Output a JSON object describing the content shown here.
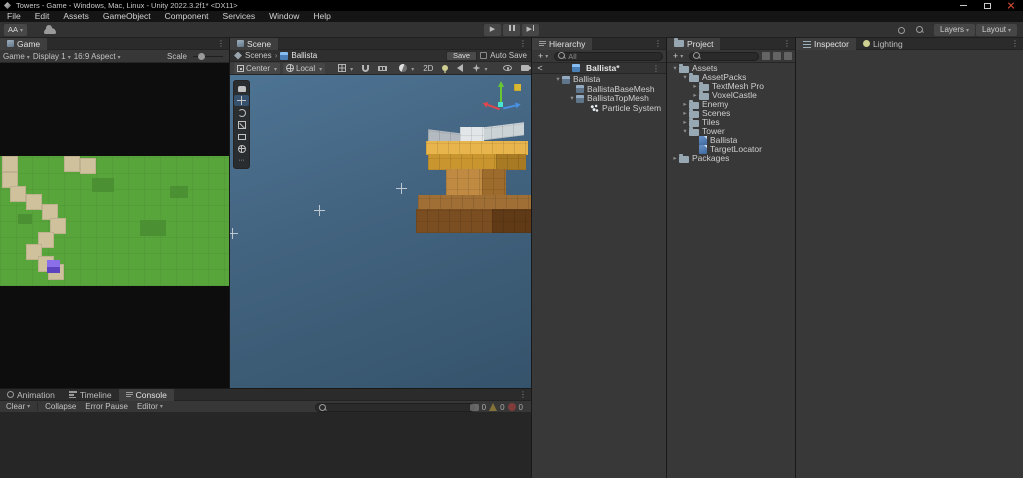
{
  "titlebar": {
    "title": "Towers - Game - Windows, Mac, Linux - Unity 2022.3.2f1* <DX11>"
  },
  "menubar": {
    "items": [
      "File",
      "Edit",
      "Assets",
      "GameObject",
      "Component",
      "Services",
      "Window",
      "Help"
    ]
  },
  "toolbar": {
    "account": "AA",
    "layers": "Layers",
    "layout": "Layout"
  },
  "game": {
    "tab": "Game",
    "mode": "Game",
    "display": "Display 1",
    "aspect": "16:9 Aspect",
    "scale_label": "Scale"
  },
  "scene": {
    "tab": "Scene",
    "breadcrumb_scene": "Scenes",
    "breadcrumb_prefab": "Ballista",
    "save": "Save",
    "auto_save": "Auto Save",
    "pivot": "Center",
    "orientation": "Local",
    "mode_2d": "2D"
  },
  "hierarchy": {
    "tab": "Hierarchy",
    "search_placeholder": "All",
    "prefab_root": "Ballista*",
    "items": [
      {
        "arrow": "▾",
        "label": "Ballista",
        "depth": 0
      },
      {
        "arrow": "",
        "label": "BallistaBaseMesh",
        "depth": 1
      },
      {
        "arrow": "▾",
        "label": "BallistaTopMesh",
        "depth": 1
      },
      {
        "arrow": "",
        "label": "Particle System",
        "depth": 2
      }
    ]
  },
  "project": {
    "tab": "Project",
    "items": [
      {
        "arrow": "▾",
        "label": "Assets",
        "depth": 0,
        "icon": "folder"
      },
      {
        "arrow": "▾",
        "label": "AssetPacks",
        "depth": 1,
        "icon": "folder"
      },
      {
        "arrow": "▸",
        "label": "TextMesh Pro",
        "depth": 2,
        "icon": "folder"
      },
      {
        "arrow": "▸",
        "label": "VoxelCastle",
        "depth": 2,
        "icon": "folder"
      },
      {
        "arrow": "▸",
        "label": "Enemy",
        "depth": 1,
        "icon": "folder"
      },
      {
        "arrow": "▸",
        "label": "Scenes",
        "depth": 1,
        "icon": "folder"
      },
      {
        "arrow": "▸",
        "label": "Tiles",
        "depth": 1,
        "icon": "folder"
      },
      {
        "arrow": "▾",
        "label": "Tower",
        "depth": 1,
        "icon": "folder"
      },
      {
        "arrow": "",
        "label": "Ballista",
        "depth": 2,
        "icon": "script"
      },
      {
        "arrow": "",
        "label": "TargetLocator",
        "depth": 2,
        "icon": "script"
      },
      {
        "arrow": "▸",
        "label": "Packages",
        "depth": 0,
        "icon": "folder"
      }
    ]
  },
  "inspector": {
    "tab": "Inspector",
    "tab_lighting": "Lighting"
  },
  "bottom": {
    "tabs": [
      "Animation",
      "Timeline",
      "Console"
    ],
    "console": {
      "clear": "Clear",
      "collapse": "Collapse",
      "error_pause": "Error Pause",
      "editor": "Editor",
      "info_count": "0",
      "warn_count": "0",
      "error_count": "0"
    }
  },
  "colors": {
    "selection_blue": "#2C5D87",
    "scene_sky_top": "#4e7494",
    "scene_sky_bottom": "#35536b",
    "grass_green": "#58a53c",
    "path_tan": "#cec19c",
    "enemy_purple": "#7a5fd8",
    "gizmo_x_red": "#e0474c",
    "gizmo_y_green": "#67c832",
    "gizmo_z_blue": "#4a90e2"
  }
}
